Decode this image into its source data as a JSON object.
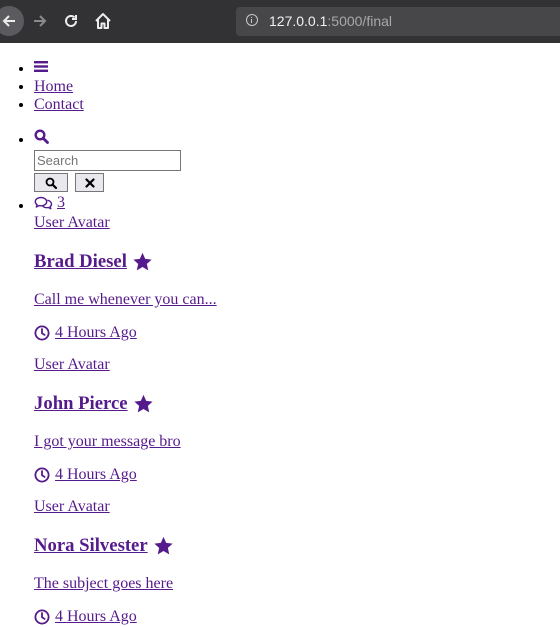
{
  "browser": {
    "url_host": "127.0.0.1",
    "url_path": ":5000/final"
  },
  "nav": {
    "menu_icon": "bars-icon",
    "items": [
      "Home",
      "Contact"
    ]
  },
  "search": {
    "icon": "search-icon",
    "placeholder": "Search",
    "value": "",
    "submit_icon": "search-icon",
    "clear_icon": "close-icon"
  },
  "messages": {
    "icon": "comments-icon",
    "count": "3",
    "items": [
      {
        "avatar_alt": "User Avatar",
        "name": "Brad Diesel",
        "subject": "Call me whenever you can...",
        "time": "4 Hours Ago",
        "star_icon": "star-icon",
        "clock_icon": "clock-icon"
      },
      {
        "avatar_alt": "User Avatar",
        "name": "John Pierce",
        "subject": "I got your message bro",
        "time": "4 Hours Ago",
        "star_icon": "star-icon",
        "clock_icon": "clock-icon"
      },
      {
        "avatar_alt": "User Avatar",
        "name": "Nora Silvester",
        "subject": "The subject goes here",
        "time": "4 Hours Ago",
        "star_icon": "star-icon",
        "clock_icon": "clock-icon"
      }
    ]
  },
  "colors": {
    "link": "#551a8b",
    "chrome_bg": "#323234",
    "urlbar_bg": "#474749"
  }
}
